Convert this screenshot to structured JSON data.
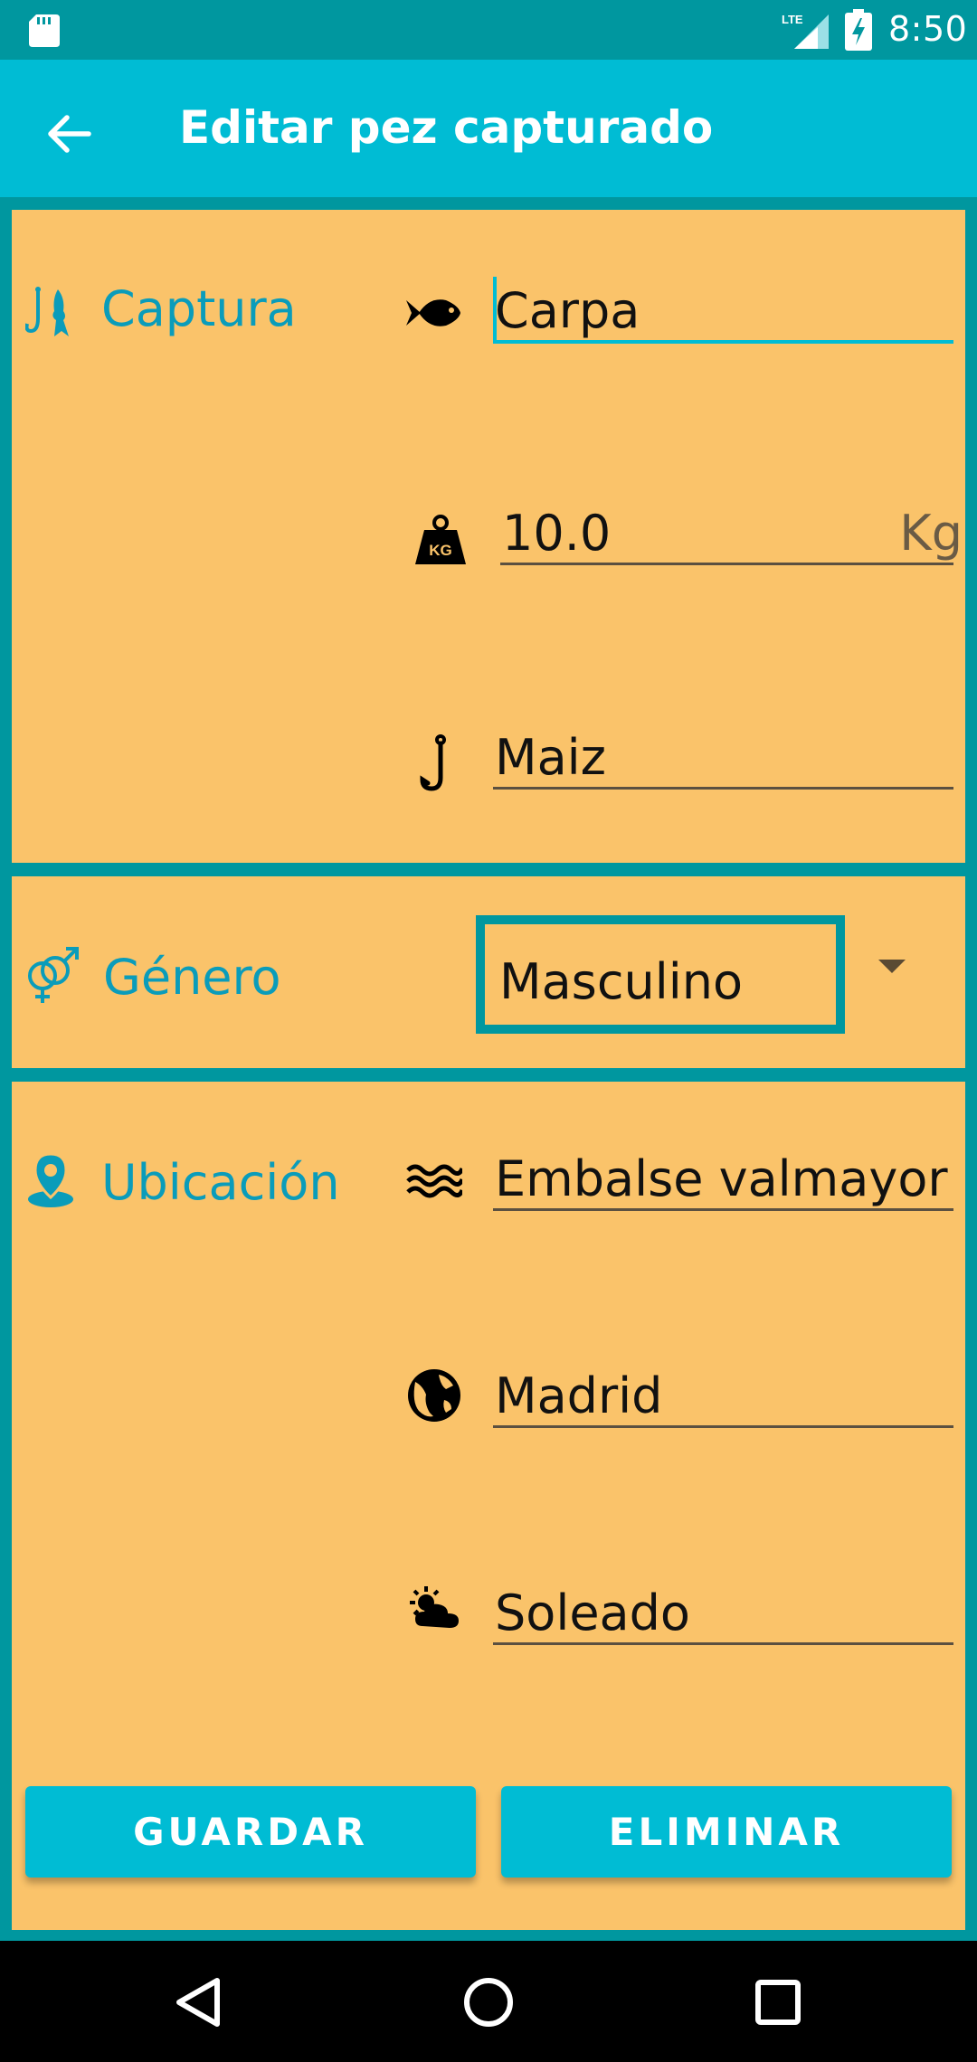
{
  "status_bar": {
    "time": "8:50",
    "network": "LTE"
  },
  "app_bar": {
    "title": "Editar pez capturado",
    "back_icon": "arrow-left-icon"
  },
  "captura": {
    "label": "Captura",
    "species": {
      "icon": "fish-icon",
      "value": "Carpa"
    },
    "weight": {
      "icon": "kg-weight-icon",
      "value": "10.0",
      "unit": "Kg"
    },
    "bait": {
      "icon": "hook-icon",
      "value": "Maiz"
    }
  },
  "genero": {
    "label": "Género",
    "icon": "gender-icon",
    "selected": "Masculino"
  },
  "ubicacion": {
    "label": "Ubicación",
    "icon": "location-pin-icon",
    "place": {
      "icon": "waves-icon",
      "value": "Embalse valmayor"
    },
    "region": {
      "icon": "globe-icon",
      "value": "Madrid"
    },
    "weather": {
      "icon": "sun-cloud-icon",
      "value": "Soleado"
    }
  },
  "buttons": {
    "save": "GUARDAR",
    "delete": "ELIMINAR"
  },
  "colors": {
    "primary": "#00BCD4",
    "primary_dark": "#00979F",
    "card": "#FAC36A",
    "accent_text": "#0A9CBA"
  }
}
